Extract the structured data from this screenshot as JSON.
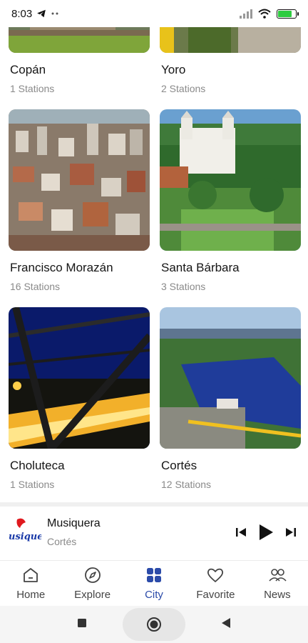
{
  "status_bar": {
    "time": "8:03",
    "icons": [
      "telegram-icon",
      "more-dots-icon",
      "signal-icon",
      "wifi-icon",
      "battery-icon"
    ],
    "battery_color": "#2ecc40"
  },
  "cities": [
    {
      "name": "Copán",
      "stations": "1 Stations"
    },
    {
      "name": "Yoro",
      "stations": "2 Stations"
    },
    {
      "name": "Francisco Morazán",
      "stations": "16 Stations"
    },
    {
      "name": "Santa Bárbara",
      "stations": "3 Stations"
    },
    {
      "name": "Choluteca",
      "stations": "1 Stations"
    },
    {
      "name": "Cortés",
      "stations": "12 Stations"
    }
  ],
  "player": {
    "title": "Musiquera",
    "subtitle": "Cortés",
    "logo_text": "usiquer",
    "controls": [
      "skip-previous-icon",
      "play-icon",
      "skip-next-icon"
    ]
  },
  "nav": {
    "items": [
      {
        "label": "Home",
        "icon": "home-icon"
      },
      {
        "label": "Explore",
        "icon": "compass-icon"
      },
      {
        "label": "City",
        "icon": "grid-icon"
      },
      {
        "label": "Favorite",
        "icon": "heart-icon"
      },
      {
        "label": "News",
        "icon": "people-icon"
      }
    ],
    "active_index": 2,
    "active_color": "#2b4ba9"
  },
  "system_nav": [
    "recents-icon",
    "home-circle-icon",
    "back-icon"
  ]
}
